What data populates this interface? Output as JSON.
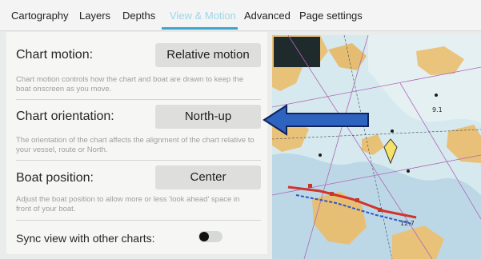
{
  "tabs": [
    {
      "label": "Cartography",
      "active": false
    },
    {
      "label": "Layers",
      "active": false
    },
    {
      "label": "Depths",
      "active": false
    },
    {
      "label": "View & Motion",
      "active": true
    },
    {
      "label": "Advanced",
      "active": false
    },
    {
      "label": "Page settings",
      "active": false
    }
  ],
  "settings": {
    "chart_motion": {
      "label": "Chart motion:",
      "value": "Relative motion",
      "description": "Chart motion controls how the chart and boat are drawn to keep the boat onscreen as you move."
    },
    "chart_orientation": {
      "label": "Chart orientation:",
      "value": "North-up",
      "description": "The orientation of the chart affects the alignment of the chart relative to your vessel, route or North."
    },
    "boat_position": {
      "label": "Boat position:",
      "value": "Center",
      "description": "Adjust the boat position to allow more or less 'look ahead' space in front of your boat."
    },
    "sync_view": {
      "label": "Sync view with other charts:",
      "enabled": false
    }
  },
  "map": {
    "labels": {
      "depth1": "12.7",
      "depth2": "9.1"
    }
  },
  "colors": {
    "accent": "#3aa5cf",
    "arrow": "#2f63c0",
    "land": "#e9c27a",
    "water": "#d6e9ef"
  }
}
